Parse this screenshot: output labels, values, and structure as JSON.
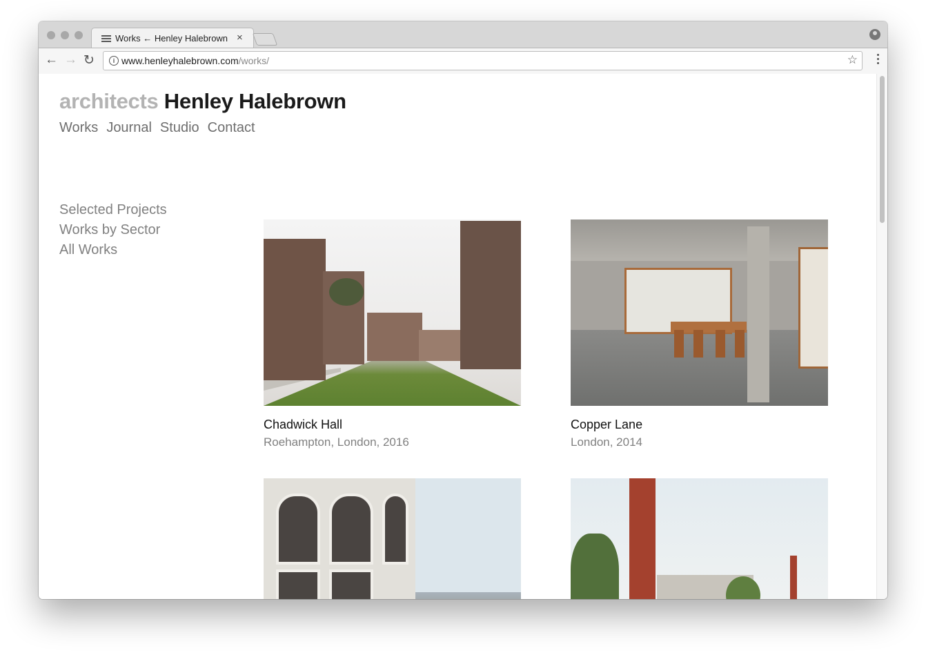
{
  "browser": {
    "tab_title": "Works ← Henley Halebrown",
    "tab_close": "×",
    "url_host": "www.henleyhalebrown.com",
    "url_path": "/works/"
  },
  "site": {
    "logo_light": "architects",
    "logo_dark": "Henley Halebrown",
    "nav": [
      "Works",
      "Journal",
      "Studio",
      "Contact"
    ],
    "subnav": [
      "Selected Projects",
      "Works by Sector",
      "All Works"
    ]
  },
  "projects": [
    {
      "title": "Chadwick Hall",
      "meta": "Roehampton, London, 2016"
    },
    {
      "title": "Copper Lane",
      "meta": "London, 2014"
    }
  ],
  "colors": {
    "logo_light": "#b3b3b3",
    "logo_dark": "#1a1a1a",
    "nav": "#6e6e6e",
    "meta": "#808080"
  }
}
